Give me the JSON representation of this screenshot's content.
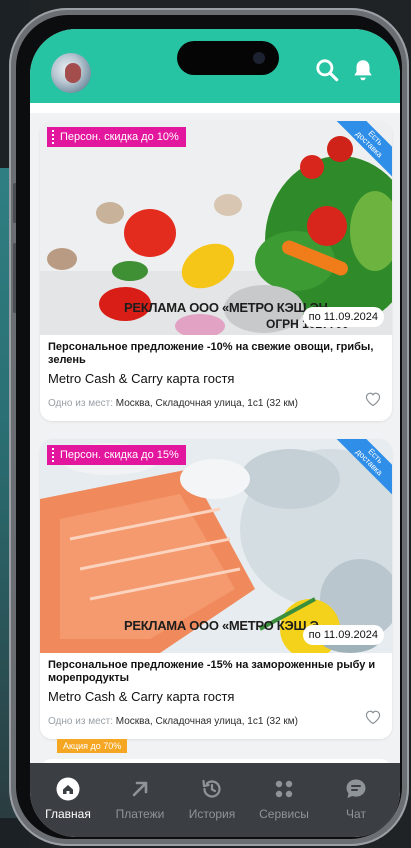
{
  "header": {
    "avatar": "avatar",
    "search_icon": "search-icon",
    "bell_icon": "bell-icon",
    "accent_color": "#27c4a3"
  },
  "offers": [
    {
      "discount_badge": "Персон. скидка до 10%",
      "ribbon_line1": "Есть",
      "ribbon_line2": "доставка",
      "date": "по 11.09.2024",
      "watermark": "РЕКЛАМА ООО «МЕТРО КЭШ ЭН",
      "watermark2": "ОГРН 1027700",
      "title": "Персональное предложение -10% на свежие овощи, грибы, зелень",
      "store": "Metro Cash & Carry  карта гостя",
      "location_prefix": "Одно из мест:",
      "location": "Москва, Складочная улица, 1с1 (32 км)"
    },
    {
      "discount_badge": "Персон. скидка до 15%",
      "ribbon_line1": "Есть",
      "ribbon_line2": "доставка",
      "date": "по 11.09.2024",
      "watermark": "РЕКЛАМА ООО «МЕТРО КЭШ Э",
      "watermark2": "",
      "title": "Персональное предложение -15% на замороженные рыбу и морепродукты",
      "store": "Metro Cash & Carry  карта гостя",
      "location_prefix": "Одно из мест:",
      "location": "Москва, Складочная улица, 1с1 (32 км)"
    }
  ],
  "partial_offer": {
    "promo_badge": "Акция до 70%"
  },
  "tabbar": {
    "tabs": [
      {
        "label": "Главная",
        "icon": "home-icon",
        "active": true
      },
      {
        "label": "Платежи",
        "icon": "arrow-up-right-icon",
        "active": false
      },
      {
        "label": "История",
        "icon": "history-icon",
        "active": false
      },
      {
        "label": "Сервисы",
        "icon": "grid-dots-icon",
        "active": false
      },
      {
        "label": "Чат",
        "icon": "chat-icon",
        "active": false
      }
    ]
  },
  "colors": {
    "discount_badge": "#e3179e",
    "delivery_ribbon": "#2f8ee8",
    "promo_badge": "#f5a623",
    "tabbar_bg": "#3b3f44"
  }
}
